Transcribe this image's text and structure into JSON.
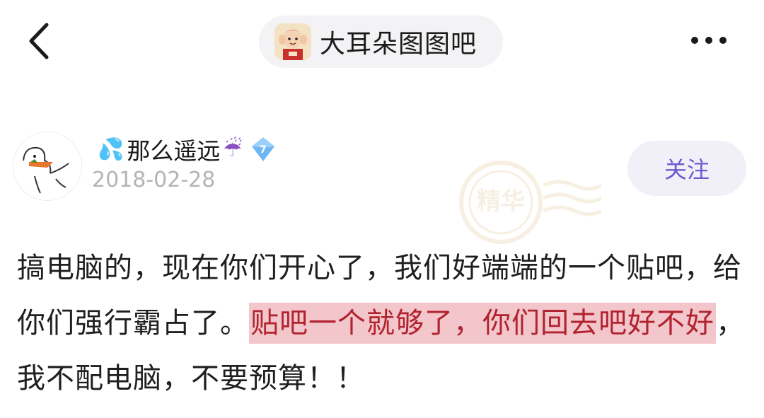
{
  "nav": {
    "back_icon": "chevron-left-icon",
    "forum_name": "大耳朵图图吧",
    "more_icon": "more-horizontal-icon"
  },
  "author": {
    "name_prefix_emoji": "💦",
    "name": "那么遥远",
    "name_suffix_emoji": "☔",
    "level": "7",
    "date": "2018-02-28",
    "follow_label": "关注"
  },
  "watermark": {
    "text": "精华"
  },
  "post": {
    "segment_1": "搞电脑的，现在你们开心了，我们好端端的一个贴吧，给你们强行霸占了。",
    "segment_2_highlight": "贴吧一个就够了，你们回去吧好不好",
    "segment_3": "，我不配电脑，不要预算！！"
  },
  "colors": {
    "highlight_bg": "#f2c6cb",
    "highlight_text": "#b0232f",
    "follow_text": "#6a5bd0",
    "follow_bg": "#f1f0f8",
    "date_text": "#b4b4b4"
  }
}
